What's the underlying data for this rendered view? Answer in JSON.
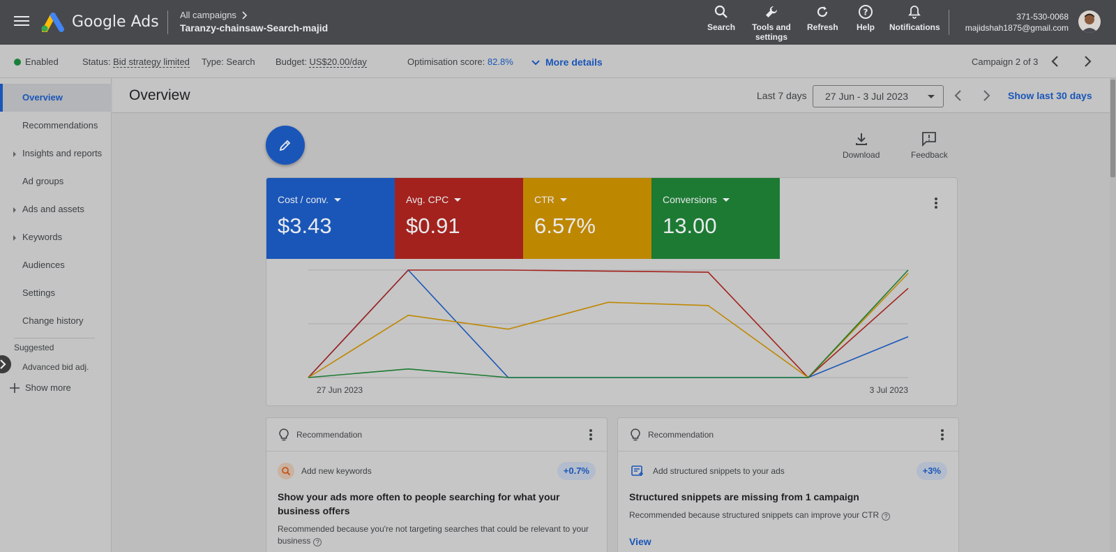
{
  "topbar": {
    "brand": "Google Ads",
    "breadcrumb_parent": "All campaigns",
    "campaign_name": "Taranzy-chainsaw-Search-majid",
    "tools": [
      {
        "label": "Search",
        "icon": "search-icon"
      },
      {
        "label": "Tools and settings",
        "icon": "wrench-icon"
      },
      {
        "label": "Refresh",
        "icon": "refresh-icon"
      },
      {
        "label": "Help",
        "icon": "help-icon"
      },
      {
        "label": "Notifications",
        "icon": "bell-icon"
      }
    ],
    "account_id": "371-530-0068",
    "account_email": "majidshah1875@gmail.com"
  },
  "statusbar": {
    "enabled": "Enabled",
    "status_label": "Status:",
    "status_value": "Bid strategy limited",
    "type_label": "Type:",
    "type_value": "Search",
    "budget_label": "Budget:",
    "budget_value": "US$20.00/day",
    "opt_label": "Optimisation score:",
    "opt_value": "82.8%",
    "more_details": "More details",
    "campaign_counter": "Campaign 2 of 3",
    "enabled_color": "#188038"
  },
  "sidebar": {
    "items": [
      {
        "label": "Overview",
        "active": true,
        "expandable": false
      },
      {
        "label": "Recommendations",
        "active": false,
        "expandable": false
      },
      {
        "label": "Insights and reports",
        "active": false,
        "expandable": true
      },
      {
        "label": "Ad groups",
        "active": false,
        "expandable": false
      },
      {
        "label": "Ads and assets",
        "active": false,
        "expandable": true
      },
      {
        "label": "Keywords",
        "active": false,
        "expandable": true
      },
      {
        "label": "Audiences",
        "active": false,
        "expandable": false
      },
      {
        "label": "Settings",
        "active": false,
        "expandable": false
      },
      {
        "label": "Change history",
        "active": false,
        "expandable": false
      }
    ],
    "suggested_label": "Suggested",
    "suggested_items": [
      {
        "label": "Advanced bid adj."
      }
    ],
    "show_more": "Show more"
  },
  "header": {
    "title": "Overview",
    "range_label": "Last 7 days",
    "date_range": "27 Jun - 3 Jul 2023",
    "show_last_30": "Show last 30 days"
  },
  "actions": {
    "download": "Download",
    "feedback": "Feedback"
  },
  "metrics": [
    {
      "label": "Cost / conv.",
      "value": "$3.43",
      "color": "#1a56b8"
    },
    {
      "label": "Avg. CPC",
      "value": "$0.91",
      "color": "#a3221d"
    },
    {
      "label": "CTR",
      "value": "6.57%",
      "color": "#be8700"
    },
    {
      "label": "Conversions",
      "value": "13.00",
      "color": "#1d7a33"
    }
  ],
  "chart_data": {
    "type": "line",
    "x": [
      "27 Jun 2023",
      "28 Jun 2023",
      "29 Jun 2023",
      "30 Jun 2023",
      "1 Jul 2023",
      "2 Jul 2023",
      "3 Jul 2023"
    ],
    "x_tick_labels": [
      "27 Jun 2023",
      "3 Jul 2023"
    ],
    "grid": true,
    "series": [
      {
        "name": "Cost / conv.",
        "color": "#1a56b8",
        "values": [
          0,
          1.0,
          0,
          0,
          0,
          0,
          0.38
        ]
      },
      {
        "name": "Avg. CPC",
        "color": "#a3221d",
        "values": [
          0,
          1.0,
          1.0,
          0.99,
          0.98,
          0,
          0.83
        ]
      },
      {
        "name": "CTR",
        "color": "#be8700",
        "values": [
          0,
          0.58,
          0.45,
          0.7,
          0.67,
          0,
          0.97
        ]
      },
      {
        "name": "Conversions",
        "color": "#1d7a33",
        "values": [
          0,
          0.08,
          0,
          0,
          0,
          0,
          1.0
        ]
      }
    ],
    "ylim": [
      0,
      1
    ]
  },
  "recommendations": [
    {
      "header": "Recommendation",
      "subtitle": "Add new keywords",
      "badge": "+0.7%",
      "title": "Show your ads more often to people searching for what your business offers",
      "description": "Recommended because you're not targeting searches that could be relevant to your business",
      "link": ""
    },
    {
      "header": "Recommendation",
      "subtitle": "Add structured snippets to your ads",
      "badge": "+3%",
      "title": "Structured snippets are missing from 1 campaign",
      "description": "Recommended because structured snippets can improve your CTR",
      "link": "View"
    }
  ]
}
